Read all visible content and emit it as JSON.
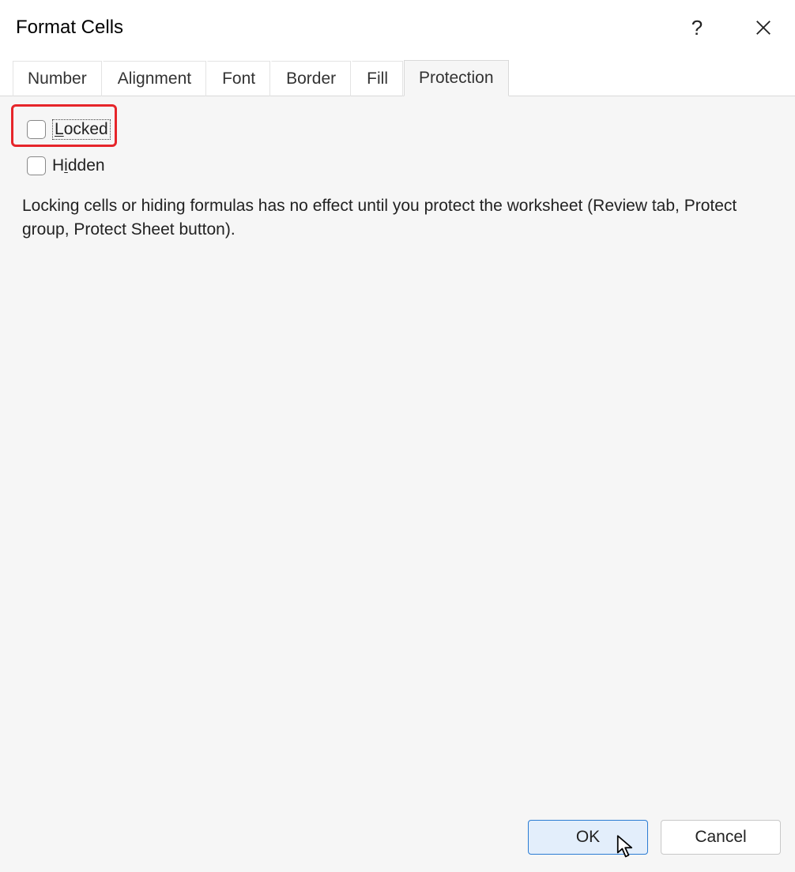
{
  "titlebar": {
    "title": "Format Cells"
  },
  "tabs": {
    "items": [
      {
        "label": "Number"
      },
      {
        "label": "Alignment"
      },
      {
        "label": "Font"
      },
      {
        "label": "Border"
      },
      {
        "label": "Fill"
      },
      {
        "label": "Protection"
      }
    ]
  },
  "protection": {
    "locked_prefix": "L",
    "locked_rest": "ocked",
    "hidden_prefix": "H",
    "hidden_accel": "i",
    "hidden_rest": "dden",
    "description": "Locking cells or hiding formulas has no effect until you protect the worksheet (Review tab, Protect group, Protect Sheet button)."
  },
  "buttons": {
    "ok": "OK",
    "cancel": "Cancel"
  }
}
